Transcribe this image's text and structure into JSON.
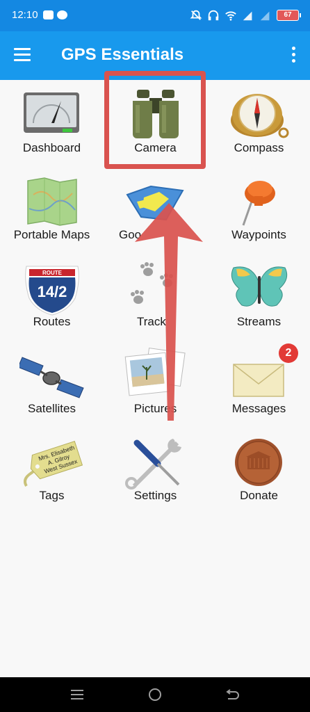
{
  "status_bar": {
    "time": "12:10",
    "battery": "67"
  },
  "app_bar": {
    "title": "GPS Essentials",
    "menu_icon": "hamburger-menu-icon",
    "overflow_icon": "more-vert-icon"
  },
  "tiles": [
    {
      "label": "Dashboard",
      "icon": "dashboard-icon"
    },
    {
      "label": "Camera",
      "icon": "binoculars-icon"
    },
    {
      "label": "Compass",
      "icon": "compass-icon"
    },
    {
      "label": "Portable Maps",
      "icon": "map-icon"
    },
    {
      "label": "Goo",
      "icon": "google-maps-icon"
    },
    {
      "label": "Waypoints",
      "icon": "pin-icon"
    },
    {
      "label": "Routes",
      "icon": "route-sign-icon"
    },
    {
      "label": "Track",
      "icon": "paw-prints-icon"
    },
    {
      "label": "Streams",
      "icon": "butterfly-icon"
    },
    {
      "label": "Satellites",
      "icon": "satellite-icon"
    },
    {
      "label": "Pictures",
      "icon": "photos-icon"
    },
    {
      "label": "Messages",
      "icon": "envelope-icon",
      "badge": "2"
    },
    {
      "label": "Tags",
      "icon": "luggage-tag-icon"
    },
    {
      "label": "Settings",
      "icon": "tools-icon"
    },
    {
      "label": "Donate",
      "icon": "penny-icon"
    }
  ],
  "tag_text": [
    "Mrs. Elisabeth",
    "A. Gilroy",
    "West Sussex"
  ],
  "route_sign": {
    "top": "ROUTE",
    "number": "14/2"
  },
  "annotation_color": "#d9534f"
}
